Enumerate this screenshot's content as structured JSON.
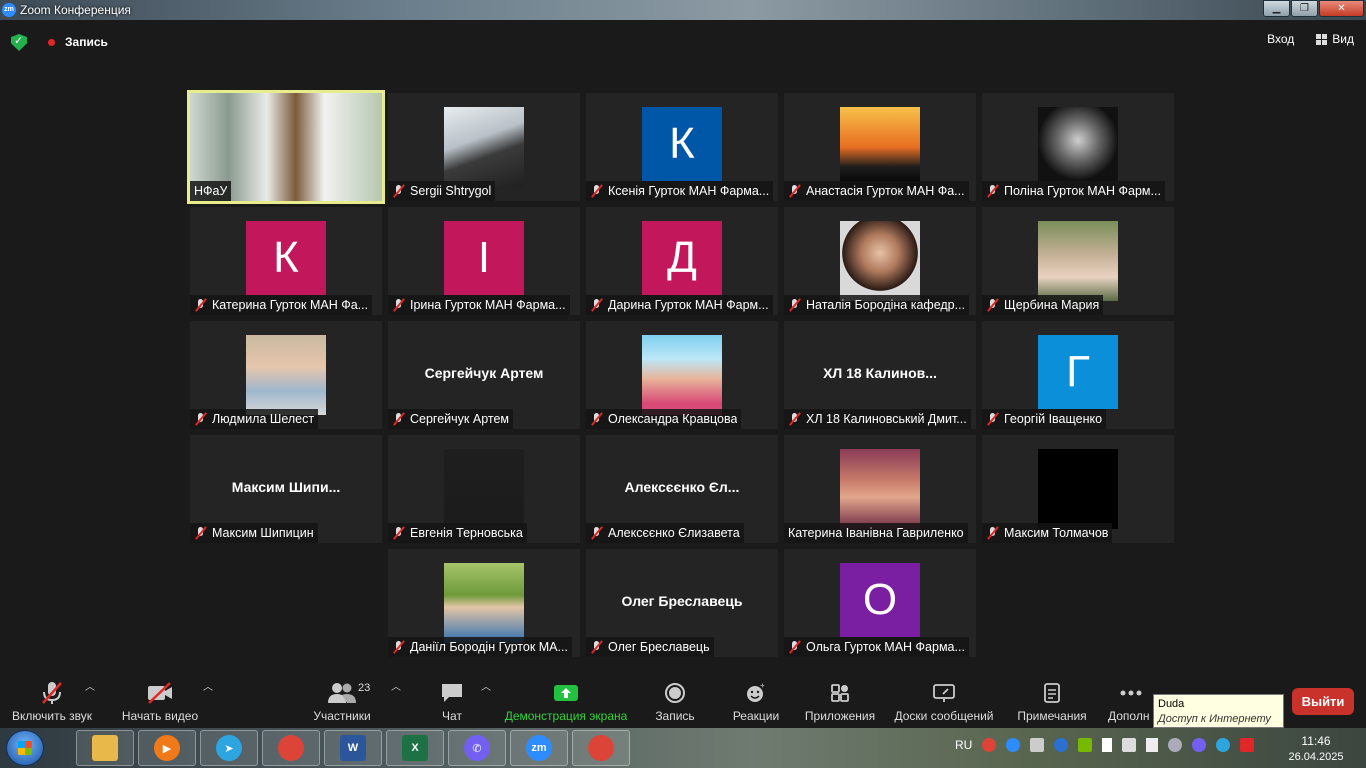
{
  "window": {
    "title": "Zoom Конференция",
    "logo_text": "zm"
  },
  "topbar": {
    "record_label": "Запись",
    "exit_fullscreen": "Вход",
    "view_label": "Вид"
  },
  "tiles": [
    {
      "name": "НФаУ",
      "muted": false,
      "active": true
    },
    {
      "name": "Sergii Shtrygol",
      "muted": true
    },
    {
      "name": "Ксенія Гурток МАН Фарма...",
      "muted": true,
      "initial": "К",
      "color": "#0057a8"
    },
    {
      "name": "Анастасія Гурток МАН Фа...",
      "muted": true
    },
    {
      "name": "Поліна Гурток МАН Фарм...",
      "muted": true
    },
    {
      "name": "Катерина Гурток МАН Фа...",
      "muted": true,
      "initial": "К",
      "color": "#c2185b"
    },
    {
      "name": "Ірина Гурток МАН Фарма...",
      "muted": true,
      "initial": "І",
      "color": "#c2185b"
    },
    {
      "name": "Дарина Гурток МАН Фарм...",
      "muted": true,
      "initial": "Д",
      "color": "#c2185b"
    },
    {
      "name": "Наталія Бородіна кафедр...",
      "muted": true
    },
    {
      "name": "Щербина Мария",
      "muted": true
    },
    {
      "name": "Людмила Шелест",
      "muted": true
    },
    {
      "name": "Сергейчук Артем",
      "muted": true,
      "bigname": "Сергейчук Артем"
    },
    {
      "name": "Олександра Кравцова",
      "muted": true
    },
    {
      "name": "ХЛ 18 Калиновський Дмит...",
      "muted": true,
      "bigname": "ХЛ 18 Калинов..."
    },
    {
      "name": "Георгій Іващенко",
      "muted": true,
      "initial": "Г",
      "color": "#0b8fd8"
    },
    {
      "name": "Максим Шипицин",
      "muted": true,
      "bigname": "Максим  Шипи..."
    },
    {
      "name": "Евгенія Терновська",
      "muted": true
    },
    {
      "name": "Алексєєнко Єлизавета",
      "muted": true,
      "bigname": "Алексєєнко Єл..."
    },
    {
      "name": "Катерина Іванівна Гавриленко",
      "muted": false
    },
    {
      "name": "Максим Толмачов",
      "muted": true
    },
    {
      "name": "Даніїл Бородін Гурток МА...",
      "muted": true
    },
    {
      "name": "Олег Бреславець",
      "muted": true,
      "bigname": "Олег Бреславець"
    },
    {
      "name": "Ольга Гурток МАН Фарма...",
      "muted": true,
      "initial": "О",
      "color": "#7b1fa2"
    }
  ],
  "toolbar": {
    "unmute": "Включить звук",
    "start_video": "Начать видео",
    "participants": "Участники",
    "participants_count": "23",
    "chat": "Чат",
    "share": "Демонстрация экрана",
    "record": "Запись",
    "reactions": "Реакции",
    "apps": "Приложения",
    "whiteboards": "Доски сообщений",
    "notes": "Примечания",
    "more": "Дополн",
    "leave": "Выйти"
  },
  "tooltip": {
    "title": "Duda",
    "subtitle": "Доступ к Интернету"
  },
  "taskbar": {
    "apps": [
      {
        "name": "explorer",
        "color": "#e8b84a",
        "text": ""
      },
      {
        "name": "media",
        "color": "#f07a1a",
        "text": "▶"
      },
      {
        "name": "telegram",
        "color": "#2ca5e0",
        "text": "➤"
      },
      {
        "name": "chrome",
        "color": "#db4437",
        "text": ""
      },
      {
        "name": "word",
        "color": "#2b579a",
        "text": "W"
      },
      {
        "name": "excel",
        "color": "#1e7145",
        "text": "X"
      },
      {
        "name": "viber",
        "color": "#7360f2",
        "text": "✆"
      },
      {
        "name": "zoom",
        "color": "#2d8cff",
        "text": "zm"
      },
      {
        "name": "chrome-h",
        "color": "#db4437",
        "text": ""
      }
    ],
    "lang": "RU",
    "time": "11:46",
    "date": "26.04.2025"
  }
}
